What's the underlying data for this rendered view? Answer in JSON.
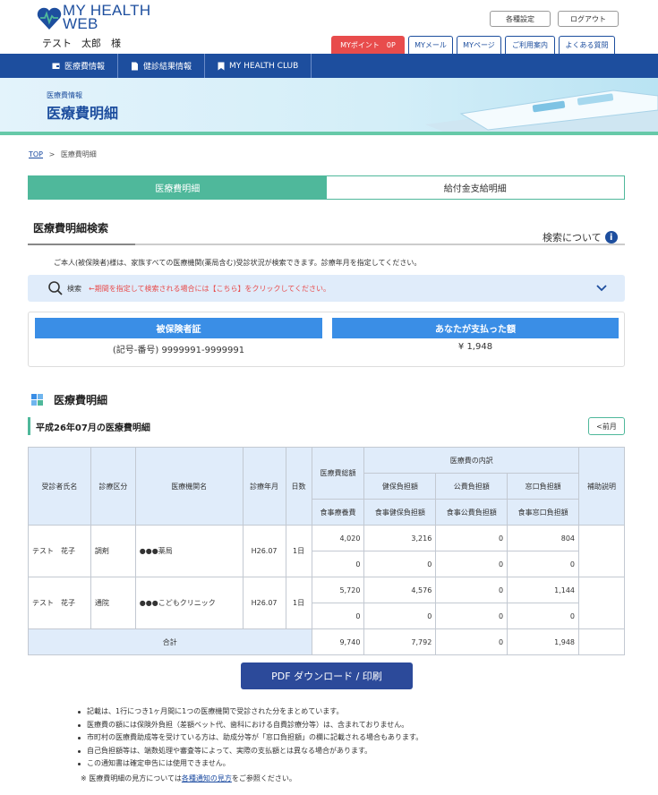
{
  "header": {
    "logo_line1": "MY HEALTH",
    "logo_line2": "WEB",
    "user_name": "テスト　太郎　様",
    "settings_label": "各種設定",
    "logout_label": "ログアウト",
    "tabs": [
      {
        "label": "MYポイント　0P",
        "color": "#e84c4c"
      },
      {
        "label": "MYメール"
      },
      {
        "label": "MYページ"
      },
      {
        "label": "ご利用案内"
      },
      {
        "label": "よくある質問"
      }
    ]
  },
  "nav": {
    "items": [
      {
        "label": "医療費情報",
        "icon": "wallet-icon"
      },
      {
        "label": "健診結果情報",
        "icon": "document-icon"
      },
      {
        "label": "MY HEALTH CLUB",
        "icon": "bookmark-icon"
      }
    ]
  },
  "banner": {
    "sub": "医療費情報",
    "title": "医療費明細"
  },
  "breadcrumb": {
    "top": "TOP",
    "sep": ">",
    "current": "医療費明細"
  },
  "segment": {
    "tab1": "医療費明細",
    "tab2": "給付金支給明細"
  },
  "search_section": {
    "title": "医療費明細検索",
    "about": "検索について",
    "description": "ご本人(被保険者)様は、家族すべての医療機関(薬局含む)受診状況が検索できます。診療年月を指定してください。",
    "search_label": "検索",
    "search_message": "←期間を指定して検索される場合には【こちら】をクリックしてください。"
  },
  "insurance": {
    "card_header": "被保険者証",
    "card_value": "(記号-番号) 9999991-9999991",
    "paid_header": "あなたが支払った額",
    "paid_value": "¥ 1,948"
  },
  "detail": {
    "title": "医療費明細",
    "period": "平成26年07月の医療費明細",
    "prev_label": "<前月"
  },
  "table": {
    "headers": {
      "patient": "受診者氏名",
      "category": "診療区分",
      "institution": "医療機関名",
      "month": "診療年月",
      "days": "日数",
      "total": "医療費総額",
      "meal": "食事療養費",
      "breakdown": "医療費の内訳",
      "health": "健保負担額",
      "public": "公費負担額",
      "window": "窓口負担額",
      "meal_health": "食事健保負担額",
      "meal_public": "食事公費負担額",
      "meal_window": "食事窓口負担額",
      "note": "補助説明"
    },
    "rows": [
      {
        "patient": "テスト　花子",
        "category": "調剤",
        "institution": "●●●薬局",
        "month": "H26.07",
        "days": "1日",
        "total": "4,020",
        "health": "3,216",
        "public": "0",
        "window": "804",
        "meal": "0",
        "meal_health": "0",
        "meal_public": "0",
        "meal_window": "0"
      },
      {
        "patient": "テスト　花子",
        "category": "通院",
        "institution": "●●●こどもクリニック",
        "month": "H26.07",
        "days": "1日",
        "total": "5,720",
        "health": "4,576",
        "public": "0",
        "window": "1,144",
        "meal": "0",
        "meal_health": "0",
        "meal_public": "0",
        "meal_window": "0"
      }
    ],
    "sum": {
      "label": "合計",
      "total": "9,740",
      "health": "7,792",
      "public": "0",
      "window": "1,948"
    }
  },
  "pdf_button": "PDF ダウンロード / 印刷",
  "notes": [
    "記載は、1行につき1ヶ月間に1つの医療機関で受診された分をまとめています。",
    "医療費の額には保険外負担（差額ベット代、歯科における自費診療分等）は、含まれておりません。",
    "市町村の医療費助成等を受けている方は、助成分等が「窓口負担額」の欄に記載される場合もあります。",
    "自己負担額等は、端数処理や審査等によって、実際の支払額とは異なる場合があります。",
    "この通知書は確定申告には使用できません。"
  ],
  "footnote": {
    "prefix": "※ 医療費明細の見方については",
    "link": "各種通知の見方",
    "suffix": "をご参照ください。"
  },
  "colors": {
    "brand": "#1d4e9e",
    "accent": "#4fb89b",
    "alert": "#e84c4c",
    "highlight": "#3a8ee6"
  }
}
